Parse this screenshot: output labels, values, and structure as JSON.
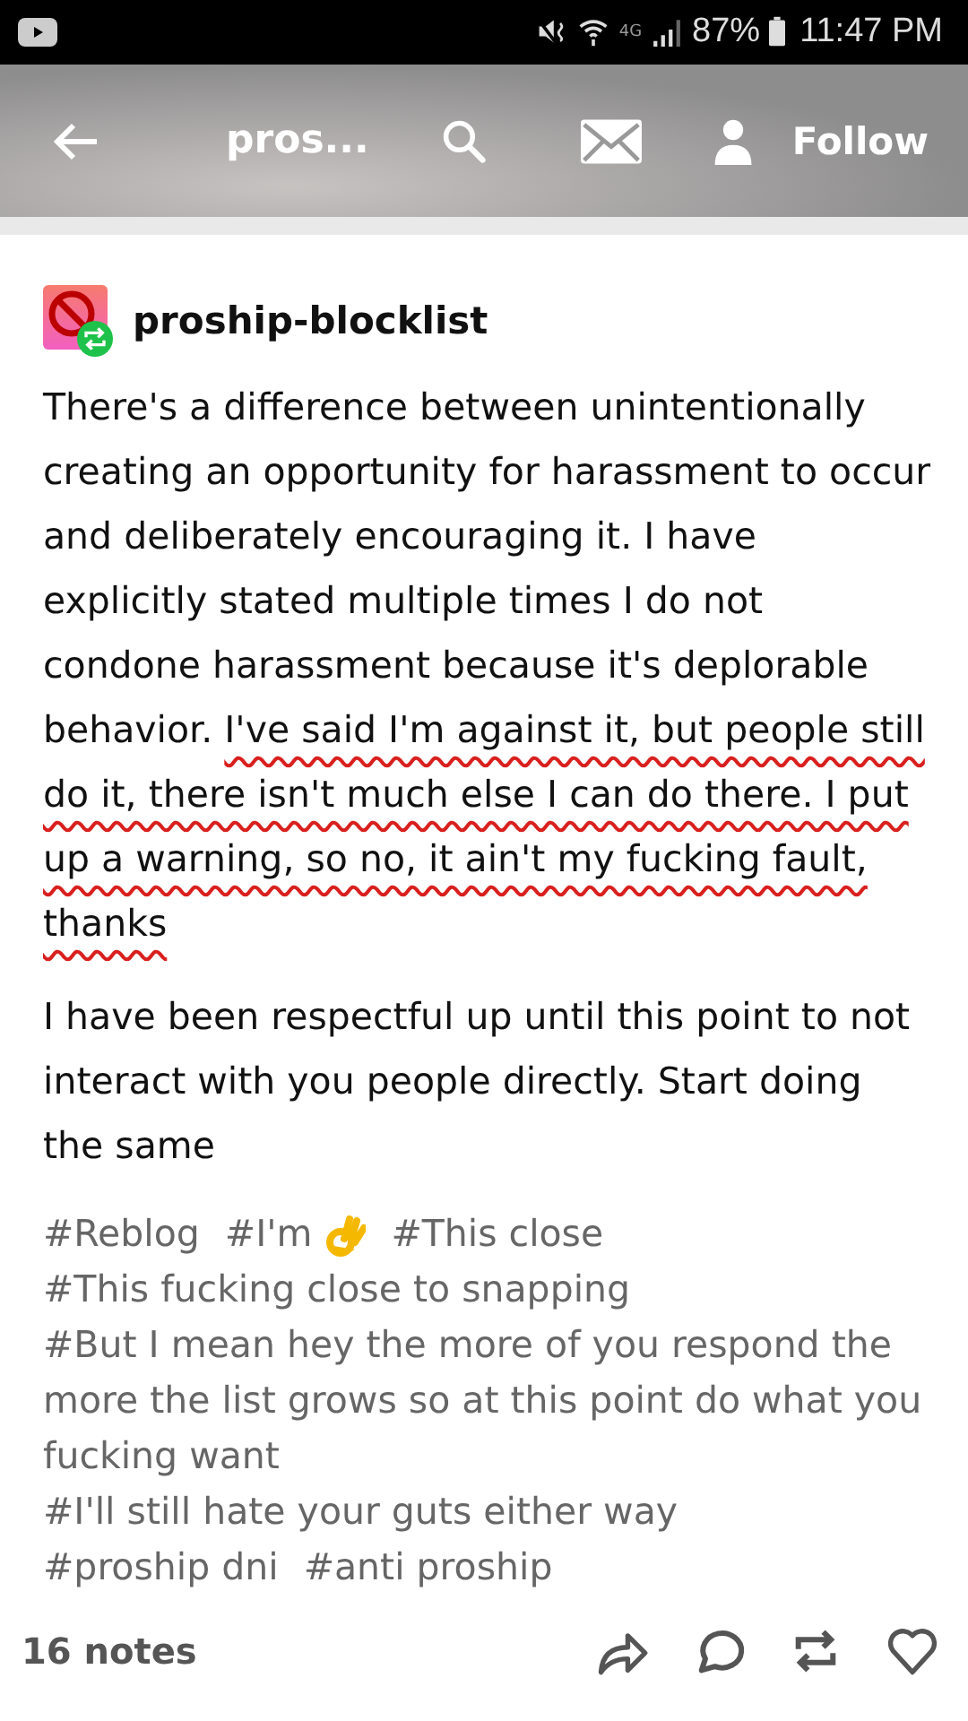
{
  "status_bar": {
    "network": "4G",
    "battery": "87%",
    "time": "11:47 PM"
  },
  "header": {
    "title": "pros...",
    "follow": "Follow"
  },
  "post": {
    "blog_name": "proship-blocklist",
    "paragraphs": [
      {
        "text": "There's a difference between unintentionally creating an opportunity for harassment to occur and deliberately encouraging it. I have explicitly stated multiple times I do not condone harassment because it's deplorable behavior. ",
        "underlined": "I've said I'm against it, but people still do it, there isn't much else I can do there. I put up a warning, so no, it ain't my fucking fault, thanks"
      },
      {
        "text": "I have been respectful up until this point to not interact with you people directly. Start doing the same"
      }
    ],
    "tags": [
      {
        "text": "#Reblog",
        "kind": "text"
      },
      {
        "text": "#I'm",
        "kind": "emoji"
      },
      {
        "text": "#This close",
        "kind": "text"
      },
      {
        "text": "#This fucking close to snapping",
        "kind": "text"
      },
      {
        "text": "#But I mean hey the more of you respond the more the list grows so at this point do what you fucking want",
        "kind": "text"
      },
      {
        "text": "#I'll still hate your guts either way",
        "kind": "text"
      },
      {
        "text": "#proship dni",
        "kind": "text"
      },
      {
        "text": "#anti proship",
        "kind": "text"
      }
    ],
    "notes": "16 notes"
  }
}
